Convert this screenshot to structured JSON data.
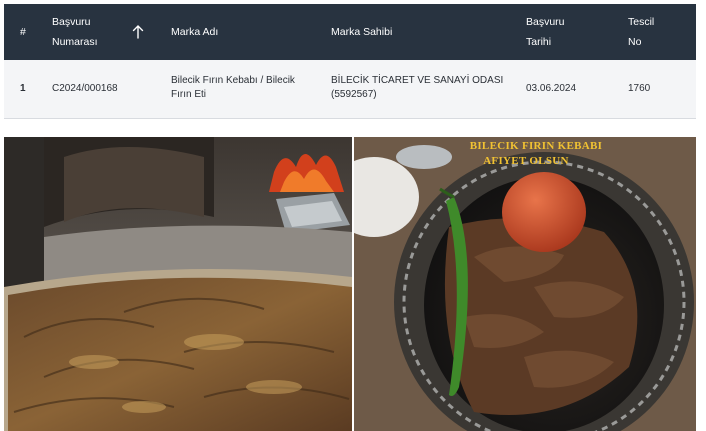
{
  "table": {
    "headers": {
      "index": "#",
      "application_number_line1": "Başvuru",
      "application_number_line2": "Numarası",
      "brand_name": "Marka Adı",
      "brand_owner": "Marka Sahibi",
      "application_date_line1": "Başvuru",
      "application_date_line2": "Tarihi",
      "registration_line1": "Tescil",
      "registration_line2": "No"
    },
    "sort_icon": "arrow-up-icon",
    "rows": [
      {
        "index": "1",
        "application_number": "C2024/000168",
        "brand_name_line1": "Bilecik Fırın Kebabı / Bilecik",
        "brand_name_line2": "Fırın Eti",
        "brand_owner_line1": "BİLECİK TİCARET VE SANAYİ ODASI",
        "brand_owner_line2": "(5592567)",
        "application_date": "03.06.2024",
        "registration_no": "1760"
      }
    ]
  },
  "photos": {
    "right_caption_line1": "BILECIK FIRIN KEBABI",
    "right_caption_line2": "AFIYET OLSUN"
  },
  "colors": {
    "header_bg": "#283340",
    "row_bg": "#f4f5f7",
    "caption": "#f1c232"
  }
}
